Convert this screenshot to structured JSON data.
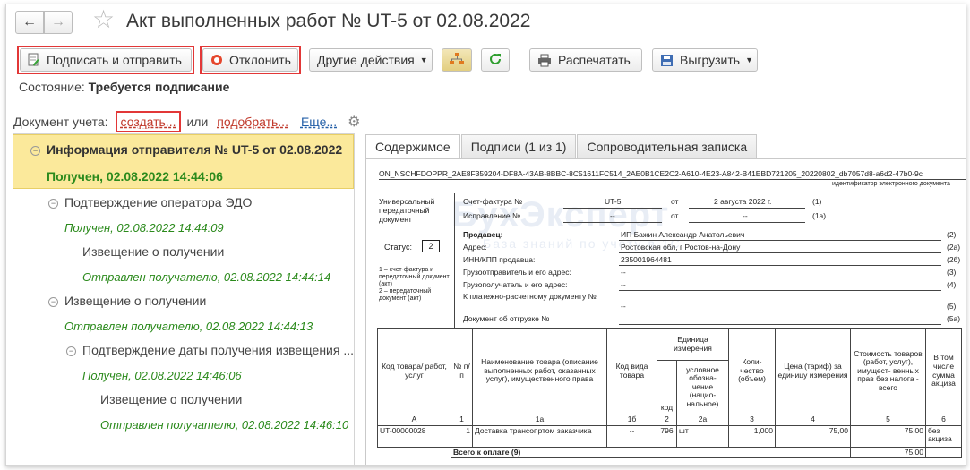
{
  "window": {
    "title": "Акт выполненных работ № UT-5 от 02.08.2022"
  },
  "toolbar": {
    "sign_send": "Подписать и отправить",
    "reject": "Отклонить",
    "other_actions": "Другие действия",
    "print": "Распечатать",
    "export": "Выгрузить"
  },
  "status": {
    "label": "Состояние:",
    "value": "Требуется подписание"
  },
  "accounting": {
    "label": "Документ учета:",
    "create": "создать...",
    "or": "или",
    "pick": "подобрать...",
    "more": "Еще..."
  },
  "tree": [
    {
      "title": "Информация отправителя № UT-5 от 02.08.2022",
      "status": "Получен, 02.08.2022 14:44:06"
    },
    {
      "title": "Подтверждение оператора ЭДО",
      "status": "Получен, 02.08.2022 14:44:09"
    },
    {
      "title": "Извещение о получении",
      "status": "Отправлен получателю, 02.08.2022 14:44:14"
    },
    {
      "title": "Извещение о получении",
      "status": "Отправлен получателю, 02.08.2022 14:44:13"
    },
    {
      "title": "Подтверждение даты получения извещения ...",
      "status": "Получен, 02.08.2022 14:46:06"
    },
    {
      "title": "Извещение о получении",
      "status": "Отправлен получателю, 02.08.2022 14:46:10"
    }
  ],
  "tabs": [
    "Содержимое",
    "Подписи (1 из 1)",
    "Сопроводительная записка"
  ],
  "watermark": {
    "main": "БухЭксперт",
    "sub": "База знаний по учету в 1С"
  },
  "doc": {
    "file_id": "ON_NSCHFDOPPR_2AE8F359204-DF8A-43AB-8BBC-8C51611FC514_2AE0B1CE2C2-A610-4E23-A842-B41EBD721205_20220802_db7057d8-a6d2-47b0-9c",
    "file_id_caption": "идентификатор электронного документа",
    "udoc_title": "Универсальный передаточный документ",
    "status_label": "Статус:",
    "status_value": "2",
    "status_note": "1 – счет-фактура и передаточный документ (акт)\n2 – передаточный документ (акт)",
    "invoice_label": "Счет-фактура №",
    "invoice_no": "UT-5",
    "from": "от",
    "invoice_date": "2 августа 2022 г.",
    "correction_label": "Исправление №",
    "dash": "--",
    "seller_label": "Продавец:",
    "seller": "ИП Бажин Александр Анатольевич",
    "address_label": "Адрес:",
    "address": "Ростовская обл, г Ростов-на-Дону",
    "inn_label": "ИНН/КПП продавца:",
    "inn": "235001964481",
    "shipper_label": "Грузоотправитель и его адрес:",
    "consignee_label": "Грузополучатель и его адрес:",
    "payment_label": "К платежно-расчетному документу №",
    "shipment_label": "Документ об отгрузке №",
    "codes": [
      "(1)",
      "(1а)",
      "(2)",
      "(2а)",
      "(2б)",
      "(3)",
      "(4)",
      "(5)",
      "(5а)"
    ],
    "table": {
      "h_code": "Код товара/ работ, услуг",
      "h_num": "№ п/п",
      "h_name": "Наименование товара (описание выполненных работ, оказанных услуг), имущественного права",
      "h_kind": "Код вида товара",
      "h_unit": "Единица измерения",
      "h_unit_code": "код",
      "h_unit_name": "условное обозна- чение (нацио- нальное)",
      "h_qty": "Коли- чество (объем)",
      "h_price": "Цена (тариф) за единицу измерения",
      "h_cost": "Стоимость товаров (работ, услуг), имущест- венных прав без налога - всего",
      "h_excise": "В том числе сумма акциза",
      "n": [
        "А",
        "1",
        "1а",
        "1б",
        "2",
        "2а",
        "3",
        "4",
        "5",
        "6"
      ],
      "row": {
        "code": "UT-00000028",
        "num": "1",
        "name": "Доставка трансопртом заказчика",
        "kind": "--",
        "unit_code": "796",
        "unit_name": "шт",
        "qty": "1,000",
        "price": "75,00",
        "cost": "75,00",
        "excise": "без акциза"
      },
      "total_label": "Всего к оплате (9)",
      "total": "75,00"
    }
  }
}
